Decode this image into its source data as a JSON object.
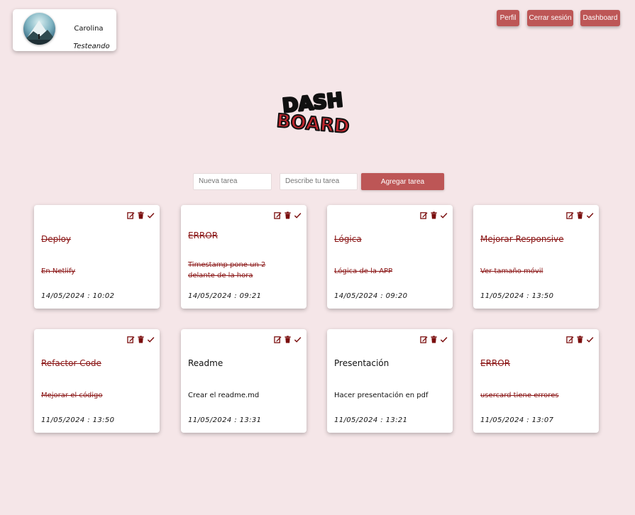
{
  "user": {
    "name": "Carolina",
    "status": "Testeando"
  },
  "nav": {
    "profile": "Perfil",
    "logout": "Cerrar sesión",
    "dashboard": "Dashboard"
  },
  "logo": {
    "line1": "DASH",
    "line2": "BOARD"
  },
  "form": {
    "title_placeholder": "Nueva tarea",
    "desc_placeholder": "Describe tu tarea",
    "add_label": "Agregar tarea"
  },
  "tasks": [
    {
      "title": "Deploy",
      "desc": "En Netlify",
      "date": "14/05/2024 : 10:02",
      "done": true
    },
    {
      "title": "ERROR",
      "desc": "Timestamp pone un 2 delante de la hora",
      "date": "14/05/2024 : 09:21",
      "done": true
    },
    {
      "title": "Lógica",
      "desc": "Lógica de la APP",
      "date": "14/05/2024 : 09:20",
      "done": true
    },
    {
      "title": "Mejorar Responsive",
      "desc": "Ver tamaño móvil",
      "date": "11/05/2024 : 13:50",
      "done": true
    },
    {
      "title": "Refactor Code",
      "desc": "Mejorar el código",
      "date": "11/05/2024 : 13:50",
      "done": true
    },
    {
      "title": "Readme",
      "desc": "Crear el readme.md",
      "date": "11/05/2024 : 13:31",
      "done": false
    },
    {
      "title": "Presentación",
      "desc": "Hacer presentación en pdf",
      "date": "11/05/2024 : 13:21",
      "done": false
    },
    {
      "title": "ERROR",
      "desc": "usercard tiene errores",
      "date": "11/05/2024 : 13:07",
      "done": true
    }
  ],
  "colors": {
    "background": "#f5e6e8",
    "accent": "#bd5656",
    "done_text": "#8a1515",
    "icon": "#7a0d0d"
  }
}
